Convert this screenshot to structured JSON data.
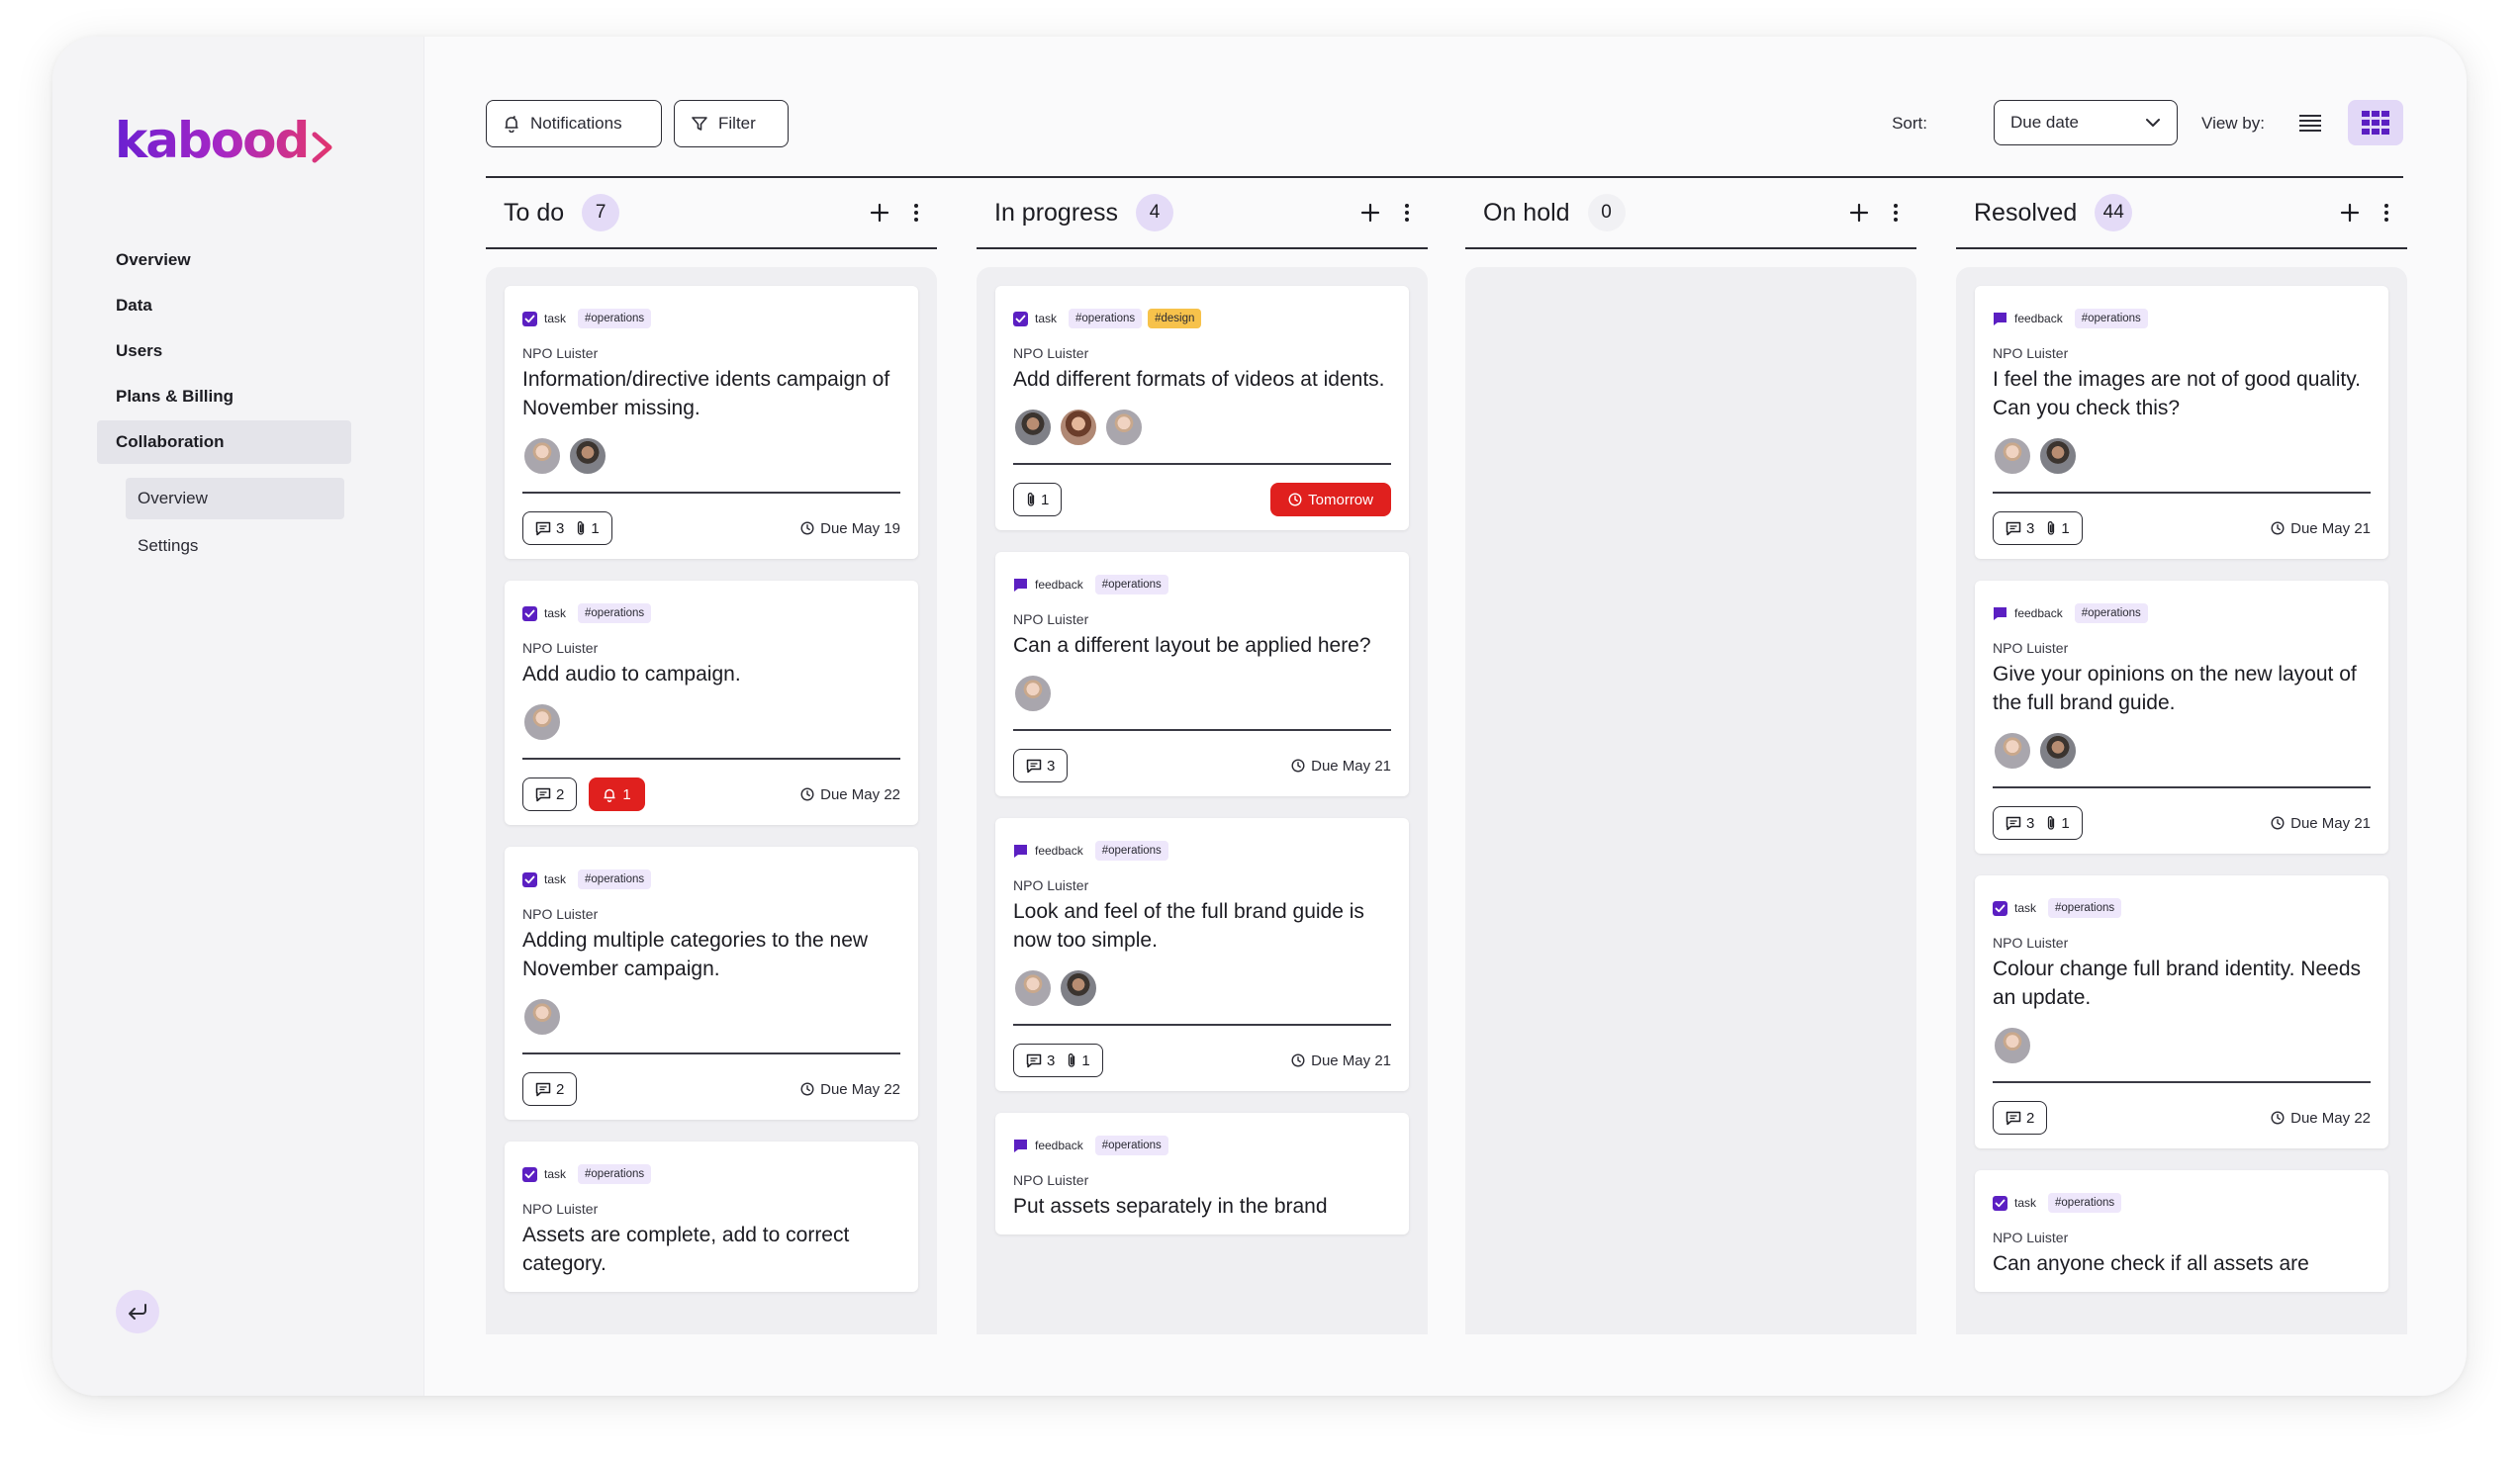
{
  "brand": {
    "logo_text": "kabood"
  },
  "sidebar": {
    "items": [
      {
        "label": "Overview"
      },
      {
        "label": "Data"
      },
      {
        "label": "Users"
      },
      {
        "label": "Plans & Billing"
      },
      {
        "label": "Collaboration"
      }
    ],
    "sub_items": [
      {
        "label": "Overview"
      },
      {
        "label": "Settings"
      }
    ]
  },
  "toolbar": {
    "notifications_label": "Notifications",
    "filter_label": "Filter",
    "sort_label": "Sort:",
    "sort_value": "Due date",
    "view_by_label": "View by:"
  },
  "colors": {
    "accent": "#6a1fd1",
    "count_bg": "#e4dbf7",
    "alert": "#e0201e",
    "design_tag": "#f7c24b"
  },
  "columns": [
    {
      "title": "To do",
      "count": "7",
      "cards": [
        {
          "type": "task",
          "tags": [
            "#operations"
          ],
          "org": "NPO Luister",
          "title": "Information/directive idents campaign of November missing.",
          "avatars": [
            "a",
            "b"
          ],
          "comments": "3",
          "attachments": "1",
          "due": "Due May 19"
        },
        {
          "type": "task",
          "tags": [
            "#operations"
          ],
          "org": "NPO Luister",
          "title": "Add audio to campaign.",
          "avatars": [
            "a"
          ],
          "comments": "2",
          "alerts": "1",
          "due": "Due May 22"
        },
        {
          "type": "task",
          "tags": [
            "#operations"
          ],
          "org": "NPO Luister",
          "title": "Adding multiple categories to the new November campaign.",
          "avatars": [
            "a"
          ],
          "comments": "2",
          "due": "Due May 22"
        },
        {
          "type": "task",
          "tags": [
            "#operations"
          ],
          "org": "NPO Luister",
          "title": "Assets are complete, add to correct category."
        }
      ]
    },
    {
      "title": "In progress",
      "count": "4",
      "cards": [
        {
          "type": "task",
          "tags": [
            "#operations",
            "#design"
          ],
          "org": "NPO Luister",
          "title": "Add different formats of videos at idents.",
          "avatars": [
            "b",
            "c",
            "a"
          ],
          "attachments": "1",
          "due_tomorrow": "Tomorrow"
        },
        {
          "type": "feedback",
          "tags": [
            "#operations"
          ],
          "org": "NPO Luister",
          "title": "Can a different layout be applied here?",
          "avatars": [
            "a"
          ],
          "comments": "3",
          "due": "Due May 21"
        },
        {
          "type": "feedback",
          "tags": [
            "#operations"
          ],
          "org": "NPO Luister",
          "title": "Look and feel of the full brand guide is now too simple.",
          "avatars": [
            "a",
            "b"
          ],
          "comments": "3",
          "attachments": "1",
          "due": "Due May 21"
        },
        {
          "type": "feedback",
          "tags": [
            "#operations"
          ],
          "org": "NPO Luister",
          "title": "Put assets separately in the brand"
        }
      ]
    },
    {
      "title": "On hold",
      "count": "0",
      "cards": []
    },
    {
      "title": "Resolved",
      "count": "44",
      "cards": [
        {
          "type": "feedback",
          "tags": [
            "#operations"
          ],
          "org": "NPO Luister",
          "title": "I feel the images are not of good quality. Can you check this?",
          "avatars": [
            "a",
            "b"
          ],
          "comments": "3",
          "attachments": "1",
          "due": "Due May 21"
        },
        {
          "type": "feedback",
          "tags": [
            "#operations"
          ],
          "org": "NPO Luister",
          "title": "Give your opinions on the new layout of the full brand guide.",
          "avatars": [
            "a",
            "b"
          ],
          "comments": "3",
          "attachments": "1",
          "due": "Due May 21"
        },
        {
          "type": "task",
          "tags": [
            "#operations"
          ],
          "org": "NPO Luister",
          "title": "Colour change full brand identity. Needs an update.",
          "avatars": [
            "a"
          ],
          "comments": "2",
          "due": "Due May 22"
        },
        {
          "type": "task",
          "tags": [
            "#operations"
          ],
          "org": "NPO Luister",
          "title": "Can anyone check if all assets are"
        }
      ]
    }
  ]
}
